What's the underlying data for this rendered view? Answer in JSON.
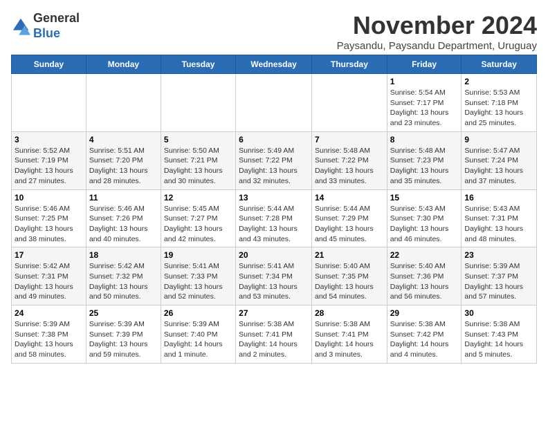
{
  "logo": {
    "general": "General",
    "blue": "Blue"
  },
  "header": {
    "month": "November 2024",
    "location": "Paysandu, Paysandu Department, Uruguay"
  },
  "days_of_week": [
    "Sunday",
    "Monday",
    "Tuesday",
    "Wednesday",
    "Thursday",
    "Friday",
    "Saturday"
  ],
  "weeks": [
    [
      {
        "day": "",
        "info": ""
      },
      {
        "day": "",
        "info": ""
      },
      {
        "day": "",
        "info": ""
      },
      {
        "day": "",
        "info": ""
      },
      {
        "day": "",
        "info": ""
      },
      {
        "day": "1",
        "info": "Sunrise: 5:54 AM\nSunset: 7:17 PM\nDaylight: 13 hours\nand 23 minutes."
      },
      {
        "day": "2",
        "info": "Sunrise: 5:53 AM\nSunset: 7:18 PM\nDaylight: 13 hours\nand 25 minutes."
      }
    ],
    [
      {
        "day": "3",
        "info": "Sunrise: 5:52 AM\nSunset: 7:19 PM\nDaylight: 13 hours\nand 27 minutes."
      },
      {
        "day": "4",
        "info": "Sunrise: 5:51 AM\nSunset: 7:20 PM\nDaylight: 13 hours\nand 28 minutes."
      },
      {
        "day": "5",
        "info": "Sunrise: 5:50 AM\nSunset: 7:21 PM\nDaylight: 13 hours\nand 30 minutes."
      },
      {
        "day": "6",
        "info": "Sunrise: 5:49 AM\nSunset: 7:22 PM\nDaylight: 13 hours\nand 32 minutes."
      },
      {
        "day": "7",
        "info": "Sunrise: 5:48 AM\nSunset: 7:22 PM\nDaylight: 13 hours\nand 33 minutes."
      },
      {
        "day": "8",
        "info": "Sunrise: 5:48 AM\nSunset: 7:23 PM\nDaylight: 13 hours\nand 35 minutes."
      },
      {
        "day": "9",
        "info": "Sunrise: 5:47 AM\nSunset: 7:24 PM\nDaylight: 13 hours\nand 37 minutes."
      }
    ],
    [
      {
        "day": "10",
        "info": "Sunrise: 5:46 AM\nSunset: 7:25 PM\nDaylight: 13 hours\nand 38 minutes."
      },
      {
        "day": "11",
        "info": "Sunrise: 5:46 AM\nSunset: 7:26 PM\nDaylight: 13 hours\nand 40 minutes."
      },
      {
        "day": "12",
        "info": "Sunrise: 5:45 AM\nSunset: 7:27 PM\nDaylight: 13 hours\nand 42 minutes."
      },
      {
        "day": "13",
        "info": "Sunrise: 5:44 AM\nSunset: 7:28 PM\nDaylight: 13 hours\nand 43 minutes."
      },
      {
        "day": "14",
        "info": "Sunrise: 5:44 AM\nSunset: 7:29 PM\nDaylight: 13 hours\nand 45 minutes."
      },
      {
        "day": "15",
        "info": "Sunrise: 5:43 AM\nSunset: 7:30 PM\nDaylight: 13 hours\nand 46 minutes."
      },
      {
        "day": "16",
        "info": "Sunrise: 5:43 AM\nSunset: 7:31 PM\nDaylight: 13 hours\nand 48 minutes."
      }
    ],
    [
      {
        "day": "17",
        "info": "Sunrise: 5:42 AM\nSunset: 7:31 PM\nDaylight: 13 hours\nand 49 minutes."
      },
      {
        "day": "18",
        "info": "Sunrise: 5:42 AM\nSunset: 7:32 PM\nDaylight: 13 hours\nand 50 minutes."
      },
      {
        "day": "19",
        "info": "Sunrise: 5:41 AM\nSunset: 7:33 PM\nDaylight: 13 hours\nand 52 minutes."
      },
      {
        "day": "20",
        "info": "Sunrise: 5:41 AM\nSunset: 7:34 PM\nDaylight: 13 hours\nand 53 minutes."
      },
      {
        "day": "21",
        "info": "Sunrise: 5:40 AM\nSunset: 7:35 PM\nDaylight: 13 hours\nand 54 minutes."
      },
      {
        "day": "22",
        "info": "Sunrise: 5:40 AM\nSunset: 7:36 PM\nDaylight: 13 hours\nand 56 minutes."
      },
      {
        "day": "23",
        "info": "Sunrise: 5:39 AM\nSunset: 7:37 PM\nDaylight: 13 hours\nand 57 minutes."
      }
    ],
    [
      {
        "day": "24",
        "info": "Sunrise: 5:39 AM\nSunset: 7:38 PM\nDaylight: 13 hours\nand 58 minutes."
      },
      {
        "day": "25",
        "info": "Sunrise: 5:39 AM\nSunset: 7:39 PM\nDaylight: 13 hours\nand 59 minutes."
      },
      {
        "day": "26",
        "info": "Sunrise: 5:39 AM\nSunset: 7:40 PM\nDaylight: 14 hours\nand 1 minute."
      },
      {
        "day": "27",
        "info": "Sunrise: 5:38 AM\nSunset: 7:41 PM\nDaylight: 14 hours\nand 2 minutes."
      },
      {
        "day": "28",
        "info": "Sunrise: 5:38 AM\nSunset: 7:41 PM\nDaylight: 14 hours\nand 3 minutes."
      },
      {
        "day": "29",
        "info": "Sunrise: 5:38 AM\nSunset: 7:42 PM\nDaylight: 14 hours\nand 4 minutes."
      },
      {
        "day": "30",
        "info": "Sunrise: 5:38 AM\nSunset: 7:43 PM\nDaylight: 14 hours\nand 5 minutes."
      }
    ]
  ]
}
